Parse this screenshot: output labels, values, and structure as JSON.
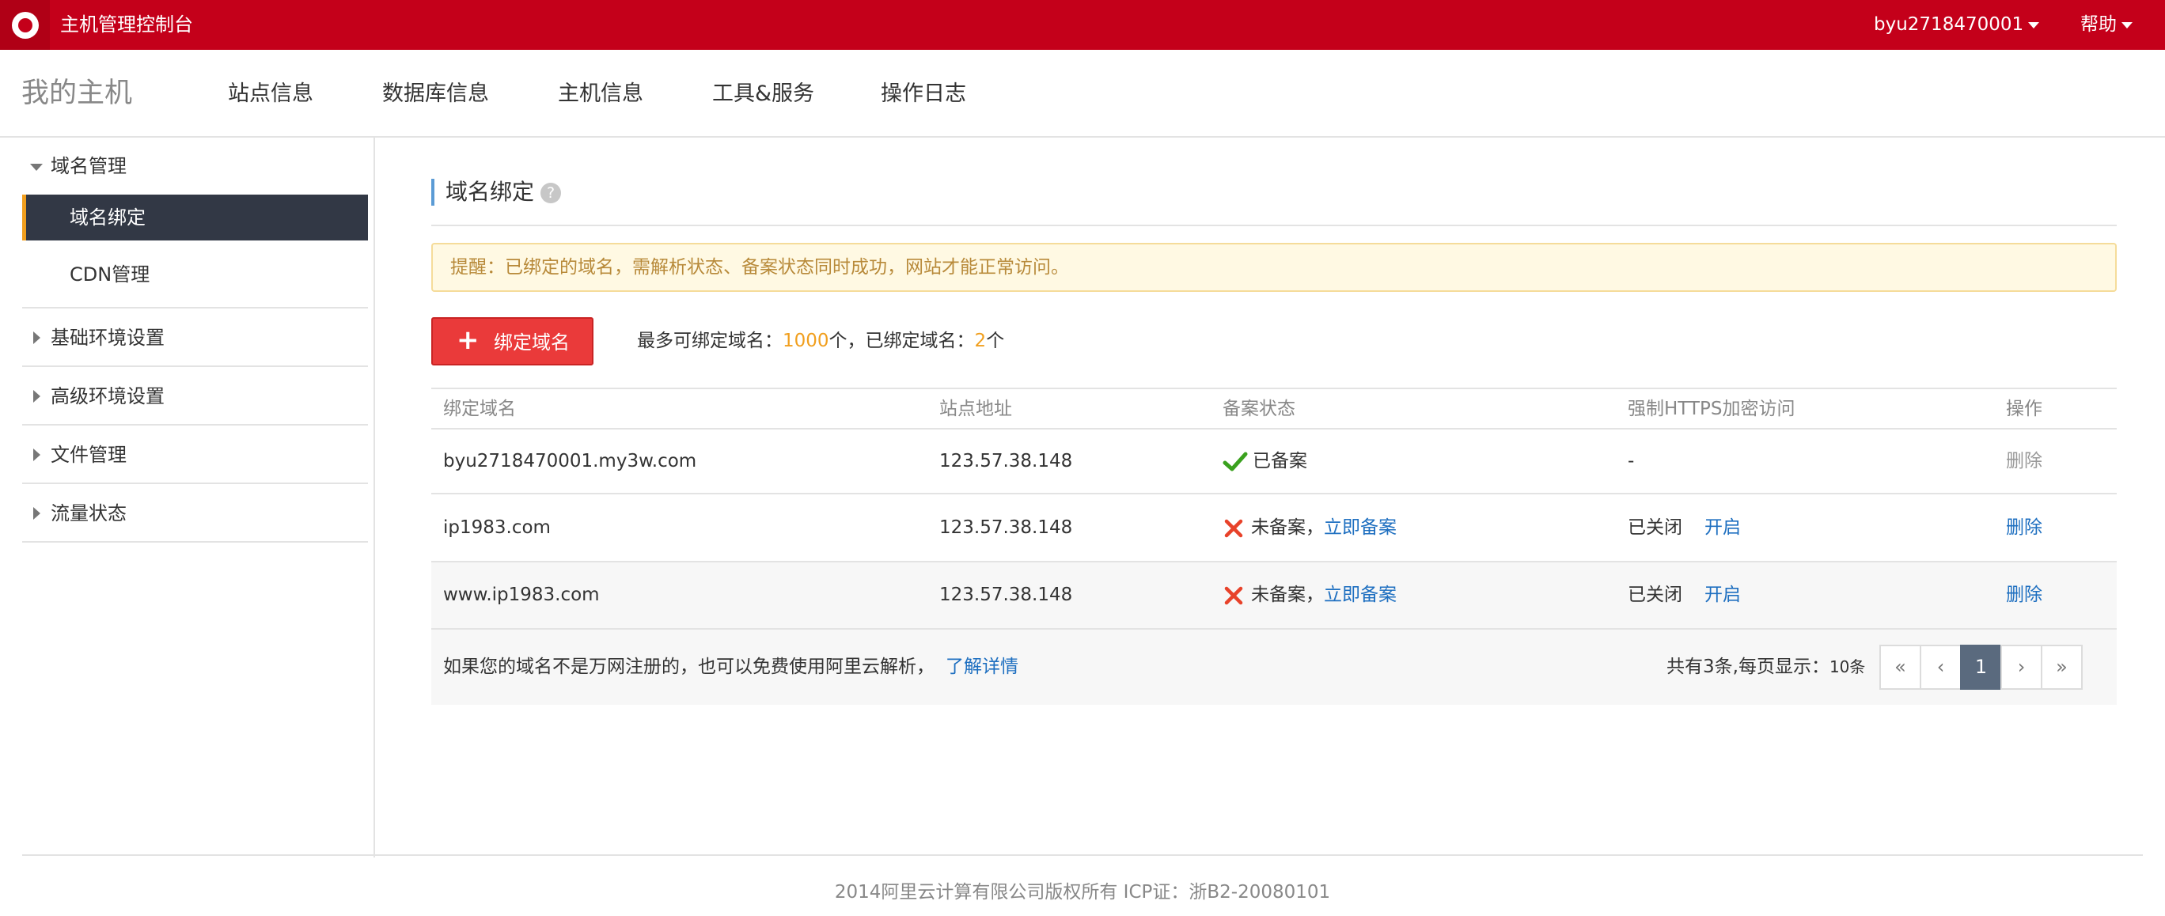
{
  "topbar": {
    "title": "主机管理控制台",
    "user": "byu2718470001",
    "help": "帮助",
    "brand_color": "#c4001a"
  },
  "nav": {
    "brand": "我的主机",
    "items": [
      "站点信息",
      "数据库信息",
      "主机信息",
      "工具&服务",
      "操作日志"
    ]
  },
  "sidebar": {
    "domain_group": "域名管理",
    "domain_bind": "域名绑定",
    "cdn": "CDN管理",
    "groups": [
      "基础环境设置",
      "高级环境设置",
      "文件管理",
      "流量状态"
    ]
  },
  "main": {
    "title": "域名绑定",
    "help_glyph": "?",
    "notice": "提醒：已绑定的域名，需解析状态、备案状态同时成功，网站才能正常访问。",
    "bind_button": "绑定域名",
    "quota_prefix": "最多可绑定域名：",
    "quota_max": "1000",
    "quota_mid": "个，已绑定域名：",
    "quota_bound": "2",
    "quota_suffix": "个"
  },
  "table": {
    "headers": [
      "绑定域名",
      "站点地址",
      "备案状态",
      "强制HTTPS加密访问",
      "操作"
    ],
    "rows": [
      {
        "domain": "byu2718470001.my3w.com",
        "ip": "123.57.38.148",
        "status": "已备案",
        "action_link": "",
        "https": "-",
        "https_action": "",
        "op": "删除"
      },
      {
        "domain": "ip1983.com",
        "ip": "123.57.38.148",
        "status": "未备案，",
        "action_link": "立即备案",
        "https": "已关闭",
        "https_action": "开启",
        "op": "删除"
      },
      {
        "domain": "www.ip1983.com",
        "ip": "123.57.38.148",
        "status": "未备案，",
        "action_link": "立即备案",
        "https": "已关闭",
        "https_action": "开启",
        "op": "删除"
      }
    ],
    "footer_tip": "如果您的域名不是万网注册的，也可以免费使用阿里云解析，",
    "footer_link": "了解详情",
    "page_info": "共有3条,每页显示：",
    "page_size": "10条",
    "pager": [
      "«",
      "‹",
      "1",
      "›",
      "»"
    ]
  },
  "footer": {
    "copyright": "2014阿里云计算有限公司版权所有 ICP证：浙B2-20080101"
  }
}
